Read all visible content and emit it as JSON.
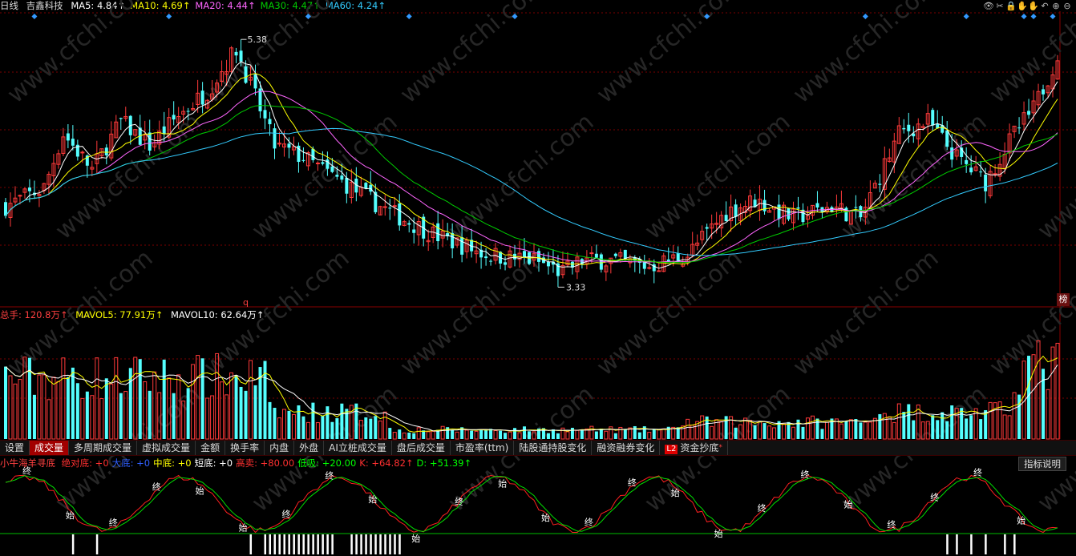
{
  "header": {
    "period": "日线",
    "stock_name": "吉鑫科技",
    "ma": [
      {
        "label": "MA5: 4.84",
        "arrow": "↑",
        "color": "#ffffff"
      },
      {
        "label": "MA10: 4.69",
        "arrow": "↑",
        "color": "#ffff00"
      },
      {
        "label": "MA20: 4.44",
        "arrow": "↑",
        "color": "#ff66ff"
      },
      {
        "label": "MA30: 4.47",
        "arrow": "↑",
        "color": "#00cc00"
      },
      {
        "label": "MA60: 4.24",
        "arrow": "↑",
        "color": "#33ccff"
      }
    ],
    "icons": [
      "eye-icon",
      "scissors-icon",
      "lock-icon",
      "hand-icon",
      "hand-icon",
      "undo-icon",
      "zoom-in-icon",
      "zoom-out-icon"
    ]
  },
  "price_chart": {
    "high_label": "5.38",
    "low_label": "3.33",
    "marker": "q",
    "badge": "榜",
    "colors": {
      "up": "#ff3a3a",
      "down": "#54ffff",
      "grid": "#7a0000"
    }
  },
  "volume": {
    "label": "总手: 120.8万",
    "mavol5": "MAVOL5: 77.91万",
    "mavol10": "MAVOL10: 62.64万",
    "arrow": "↑"
  },
  "tabs": [
    {
      "label": "设置",
      "active": false
    },
    {
      "label": "成交量",
      "active": true
    },
    {
      "label": "多周期成交量",
      "active": false
    },
    {
      "label": "虚拟成交量",
      "active": false
    },
    {
      "label": "金额",
      "active": false
    },
    {
      "label": "换手率",
      "active": false
    },
    {
      "label": "内盘",
      "active": false
    },
    {
      "label": "外盘",
      "active": false
    },
    {
      "label": "AI立桩成交量",
      "active": false
    },
    {
      "label": "盘后成交量",
      "active": false
    },
    {
      "label": "市盈率(ttm)",
      "active": false
    },
    {
      "label": "陆股通持股变化",
      "active": false
    },
    {
      "label": "融资融券变化",
      "active": false
    }
  ],
  "tab_l2": {
    "badge": "L2",
    "label": "资金抄底",
    "mark": "*"
  },
  "indicator": {
    "name": "小牛海羊寻底",
    "items": [
      {
        "text": "绝对底: +0",
        "color": "#ff3030"
      },
      {
        "text": "大底: +0",
        "color": "#3060ff"
      },
      {
        "text": "中底: +0",
        "color": "#ffff00"
      },
      {
        "text": "短底: +0",
        "color": "#ffffff"
      },
      {
        "text": "高卖: +80.00",
        "color": "#ff3030"
      },
      {
        "text": "低吸: +20.00",
        "color": "#00ff00"
      },
      {
        "text": "K: +64.82",
        "color": "#ff3030"
      },
      {
        "text": "D: +51.39",
        "color": "#00ff00"
      }
    ],
    "button": "指标说明",
    "start_label": "始",
    "end_label": "终"
  }
}
